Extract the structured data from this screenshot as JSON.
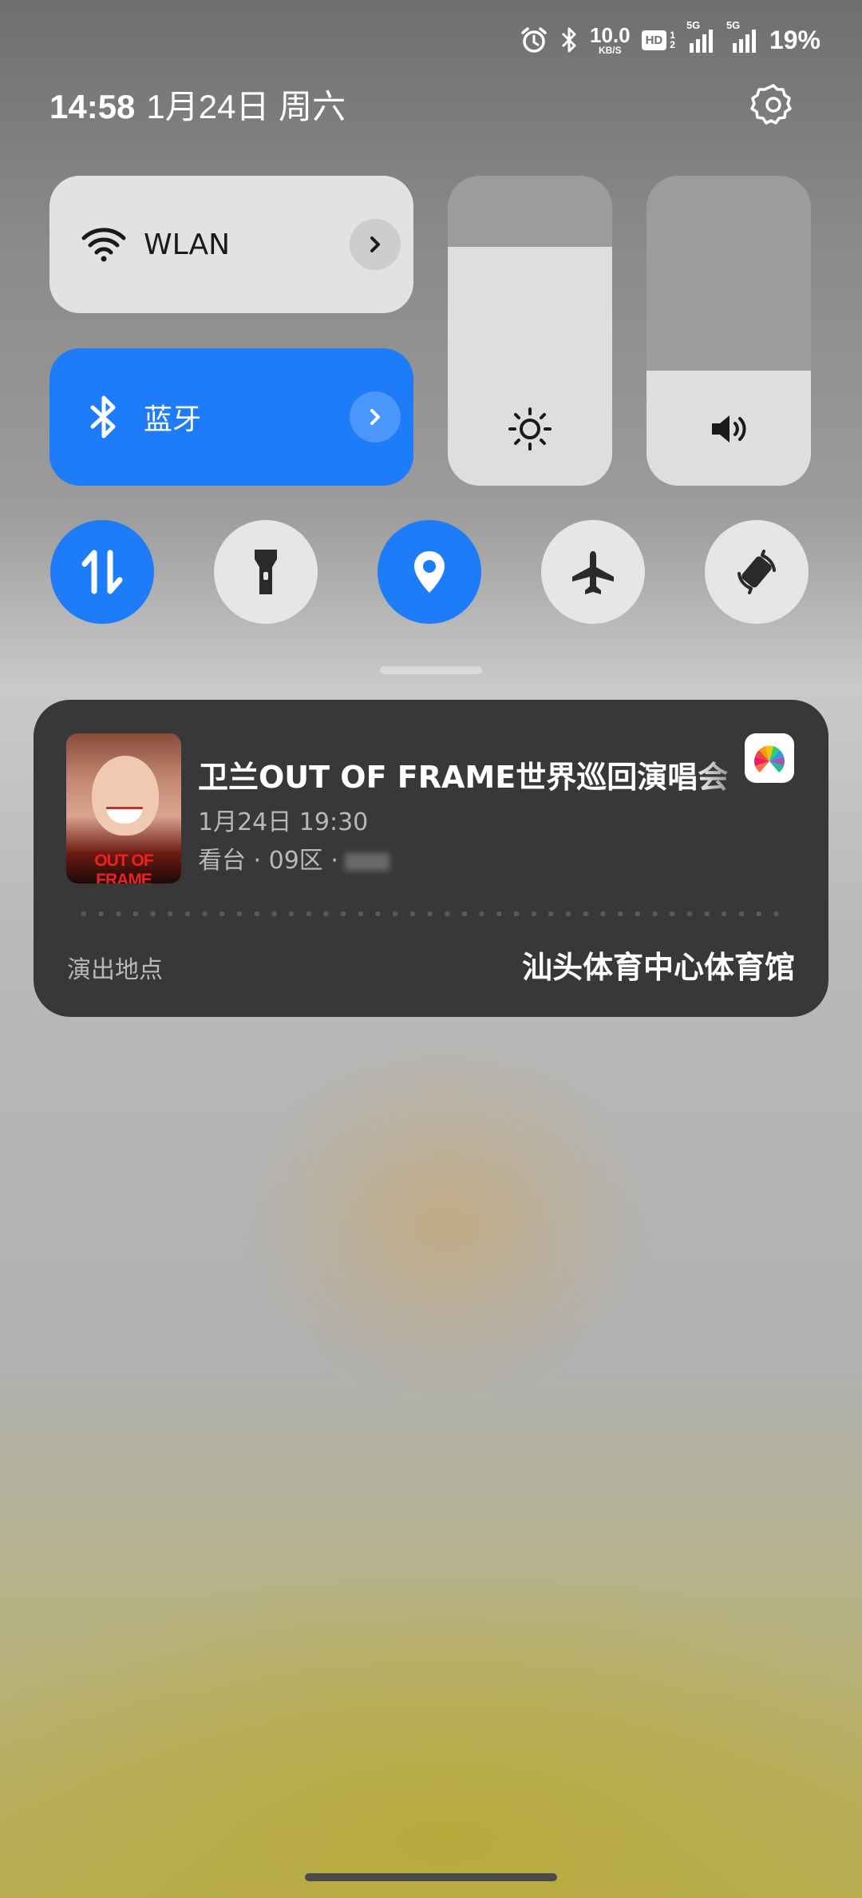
{
  "status_bar": {
    "net_speed_value": "10.0",
    "net_speed_unit": "KB/S",
    "hd_label": "HD",
    "hd_sub": "1\n2",
    "sim1_type": "5G",
    "sim2_type": "5G",
    "battery": "19%",
    "icons": [
      "alarm-icon",
      "bluetooth-icon",
      "hd-icon",
      "signal-icon",
      "signal-icon",
      "battery"
    ]
  },
  "header": {
    "time": "14:58",
    "date": "1月24日 周六"
  },
  "quick_settings": {
    "wlan_label": "WLAN",
    "bluetooth_label": "蓝牙",
    "brightness_level": 0.77,
    "volume_level": 0.37,
    "toggles": [
      {
        "icon": "mobile-data-icon",
        "on": true
      },
      {
        "icon": "flashlight-icon",
        "on": false
      },
      {
        "icon": "location-icon",
        "on": true
      },
      {
        "icon": "airplane-icon",
        "on": false
      },
      {
        "icon": "auto-rotate-icon",
        "on": false
      }
    ],
    "accent_color": "#1e7cf8"
  },
  "ticket_card": {
    "poster_title": "OUT OF FRAME",
    "title": "卫兰OUT OF FRAME世界巡回演唱会",
    "datetime": "1月24日 19:30",
    "seat": "看台 · 09区 ·",
    "venue_label": "演出地点",
    "venue": "汕头体育中心体育馆"
  }
}
